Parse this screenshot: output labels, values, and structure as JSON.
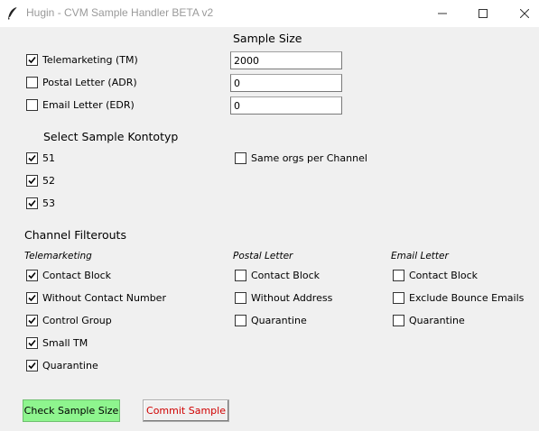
{
  "window": {
    "title": "Hugin - CVM Sample Handler BETA v2"
  },
  "sample_size": {
    "heading": "Sample Size",
    "rows": [
      {
        "label": "Telemarketing (TM)",
        "checked": true,
        "value": "2000"
      },
      {
        "label": "Postal Letter (ADR)",
        "checked": false,
        "value": "0"
      },
      {
        "label": "Email Letter (EDR)",
        "checked": false,
        "value": "0"
      }
    ]
  },
  "kontotyp": {
    "heading": "Select Sample Kontotyp",
    "items": [
      {
        "label": "51",
        "checked": true
      },
      {
        "label": "52",
        "checked": true
      },
      {
        "label": "53",
        "checked": true
      }
    ],
    "same_orgs": {
      "label": "Same orgs per Channel",
      "checked": false
    }
  },
  "filterouts": {
    "heading": "Channel Filterouts",
    "columns": [
      {
        "title": "Telemarketing",
        "items": [
          {
            "label": "Contact Block",
            "checked": true
          },
          {
            "label": "Without Contact Number",
            "checked": true
          },
          {
            "label": "Control Group",
            "checked": true
          },
          {
            "label": "Small TM",
            "checked": true
          },
          {
            "label": "Quarantine",
            "checked": true
          }
        ]
      },
      {
        "title": "Postal Letter",
        "items": [
          {
            "label": "Contact Block",
            "checked": false
          },
          {
            "label": "Without Address",
            "checked": false
          },
          {
            "label": "Quarantine",
            "checked": false
          }
        ]
      },
      {
        "title": "Email Letter",
        "items": [
          {
            "label": "Contact Block",
            "checked": false
          },
          {
            "label": "Exclude Bounce Emails",
            "checked": false
          },
          {
            "label": "Quarantine",
            "checked": false
          }
        ]
      }
    ]
  },
  "buttons": {
    "check": "Check Sample Size",
    "commit": "Commit Sample"
  },
  "colors": {
    "check_button_bg": "#8ef58e",
    "commit_text": "#d00000",
    "window_bg": "#f0f0f0"
  }
}
